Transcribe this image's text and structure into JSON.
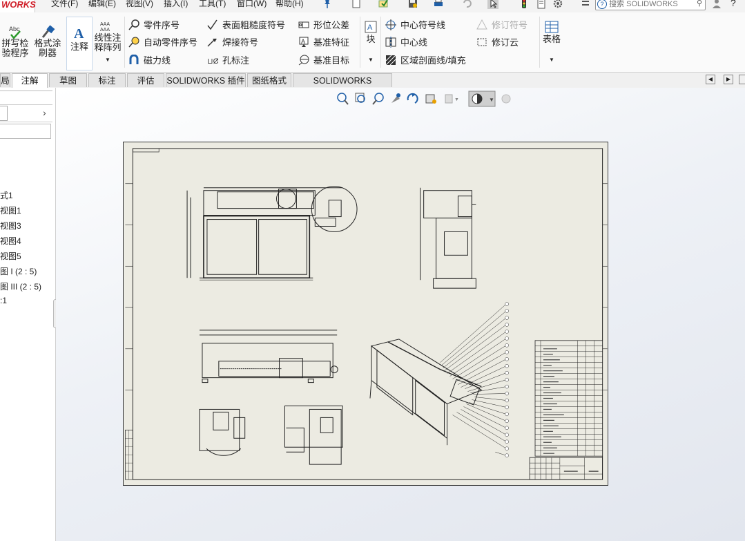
{
  "app": {
    "logo_text": "WORKS"
  },
  "menu": {
    "items": [
      "文件(F)",
      "编辑(E)",
      "视图(V)",
      "插入(I)",
      "工具(T)",
      "窗口(W)",
      "帮助(H)"
    ],
    "search_placeholder": "搜索 SOLIDWORKS"
  },
  "ribbon": {
    "spell_check": "拼写检\n验程序",
    "format_painter": "格式涂\n刷器",
    "note": "注释",
    "linear_note_pattern": "线性注\n释阵列",
    "balloon": "零件序号",
    "auto_balloon": "自动零件序号",
    "magnetic_line": "磁力线",
    "surface_finish": "表面粗糙度符号",
    "weld_symbol": "焊接符号",
    "hole_callout": "孔标注",
    "gdt": "形位公差",
    "datum_feature": "基准特征",
    "datum_target": "基准目标",
    "block": "块",
    "center_mark": "中心符号线",
    "centerline": "中心线",
    "area_hatch": "区域剖面线/填充",
    "revision_symbol": "修订符号",
    "revision_cloud": "修订云",
    "table": "表格"
  },
  "tabs": [
    {
      "label": "局"
    },
    {
      "label": "注解",
      "active": true
    },
    {
      "label": "草图"
    },
    {
      "label": "标注"
    },
    {
      "label": "评估"
    },
    {
      "label": "SOLIDWORKS 插件"
    },
    {
      "label": "图纸格式"
    },
    {
      "label": "SOLIDWORKS Inspection"
    }
  ],
  "tree": {
    "items": [
      "式1",
      "视图1",
      "视图3",
      "视图4",
      "视图5",
      "图 I (2 : 5)",
      "图 III (2 : 5)",
      ":1"
    ]
  },
  "colors": {
    "accent": "#1f5fa8",
    "sheet_bg": "#ecebe2",
    "logo_red": "#d0202a"
  }
}
